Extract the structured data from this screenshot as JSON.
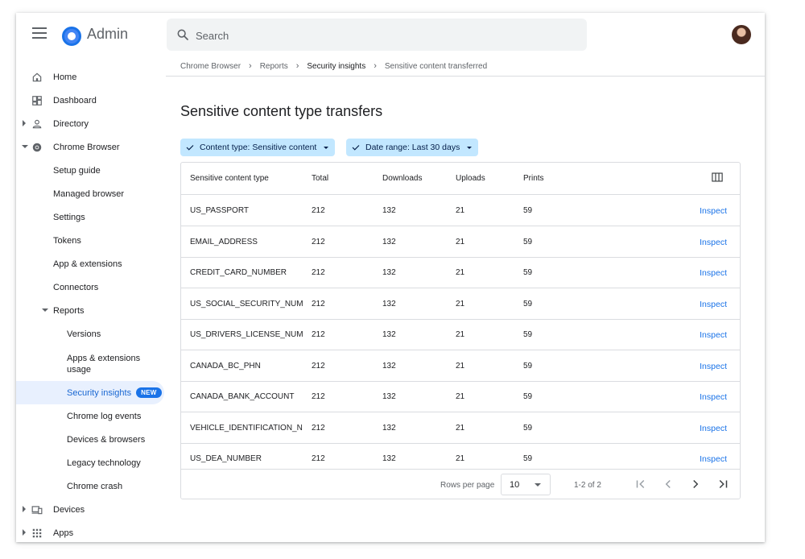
{
  "app": {
    "title": "Admin"
  },
  "search": {
    "placeholder": "Search"
  },
  "sidebar": {
    "items": [
      {
        "label": "Home"
      },
      {
        "label": "Dashboard"
      },
      {
        "label": "Directory"
      },
      {
        "label": "Chrome Browser"
      },
      {
        "label": "Setup guide"
      },
      {
        "label": "Managed browser"
      },
      {
        "label": "Settings"
      },
      {
        "label": "Tokens"
      },
      {
        "label": "App & extensions"
      },
      {
        "label": "Connectors"
      },
      {
        "label": "Reports"
      },
      {
        "label": "Versions"
      },
      {
        "label": "Apps & extensions usage"
      },
      {
        "label": "Security insights",
        "badge": "NEW"
      },
      {
        "label": "Chrome log events"
      },
      {
        "label": "Devices & browsers"
      },
      {
        "label": "Legacy technology"
      },
      {
        "label": "Chrome crash"
      },
      {
        "label": "Devices"
      },
      {
        "label": "Apps"
      }
    ]
  },
  "breadcrumb": [
    "Chrome Browser",
    "Reports",
    "Security insights",
    "Sensitive content transferred"
  ],
  "page": {
    "title": "Sensitive content type transfers",
    "filters": [
      "Content type: Sensitive content",
      "Date range: Last 30 days"
    ]
  },
  "table": {
    "headers": [
      "Sensitive content type",
      "Total",
      "Downloads",
      "Uploads",
      "Prints"
    ],
    "action_label": "Inspect",
    "rows": [
      [
        "US_PASSPORT",
        "212",
        "132",
        "21",
        "59"
      ],
      [
        "EMAIL_ADDRESS",
        "212",
        "132",
        "21",
        "59"
      ],
      [
        "CREDIT_CARD_NUMBER",
        "212",
        "132",
        "21",
        "59"
      ],
      [
        "US_SOCIAL_SECURITY_NUMB",
        "212",
        "132",
        "21",
        "59"
      ],
      [
        "US_DRIVERS_LICENSE_NUMB",
        "212",
        "132",
        "21",
        "59"
      ],
      [
        "CANADA_BC_PHN",
        "212",
        "132",
        "21",
        "59"
      ],
      [
        "CANADA_BANK_ACCOUNT",
        "212",
        "132",
        "21",
        "59"
      ],
      [
        "VEHICLE_IDENTIFICATION_NU",
        "212",
        "132",
        "21",
        "59"
      ],
      [
        "US_DEA_NUMBER",
        "212",
        "132",
        "21",
        "59"
      ]
    ]
  },
  "pagination": {
    "rows_per_page_label": "Rows per page",
    "rows_per_page_value": "10",
    "range": "1-2 of 2"
  },
  "colors": {
    "accent": "#1a73e8",
    "chip_bg": "#c2e7ff",
    "active_nav_bg": "#e8f0fe"
  }
}
